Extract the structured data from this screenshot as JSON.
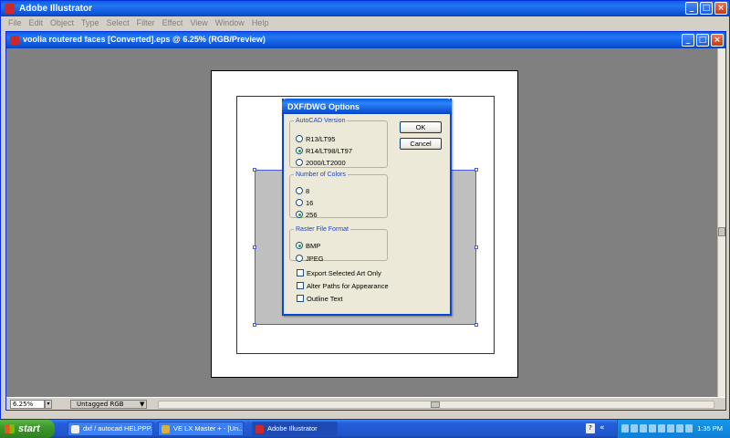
{
  "app": {
    "title": "Adobe Illustrator",
    "menus": [
      "File",
      "Edit",
      "Object",
      "Type",
      "Select",
      "Filter",
      "Effect",
      "View",
      "Window",
      "Help"
    ]
  },
  "document": {
    "title": "voolia routered faces [Converted].eps @ 6.25% (RGB/Preview)",
    "zoom": "6.25%",
    "color_profile": "Untagged RGB"
  },
  "dialog": {
    "title": "DXF/DWG Options",
    "ok_label": "OK",
    "cancel_label": "Cancel",
    "autocad_version": {
      "legend": "AutoCAD Version",
      "options": [
        "R13/LT95",
        "R14/LT98/LT97",
        "2000/LT2000"
      ],
      "selected": "R14/LT98/LT97"
    },
    "number_of_colors": {
      "legend": "Number of Colors",
      "options": [
        "8",
        "16",
        "256"
      ],
      "selected": "256"
    },
    "raster_format": {
      "legend": "Raster File Format",
      "options": [
        "BMP",
        "JPEG"
      ],
      "selected": "BMP"
    },
    "checkboxes": [
      {
        "label": "Export Selected Art Only",
        "checked": false
      },
      {
        "label": "Alter Paths for Appearance",
        "checked": false
      },
      {
        "label": "Outline Text",
        "checked": false
      }
    ]
  },
  "taskbar": {
    "start_label": "start",
    "tasks": [
      {
        "label": "dxf / autocad HELPPP...",
        "active": false
      },
      {
        "label": "VE LX Master + - [Un...",
        "active": false
      },
      {
        "label": "Adobe Illustrator",
        "active": true
      }
    ],
    "clock": "1:35 PM"
  }
}
